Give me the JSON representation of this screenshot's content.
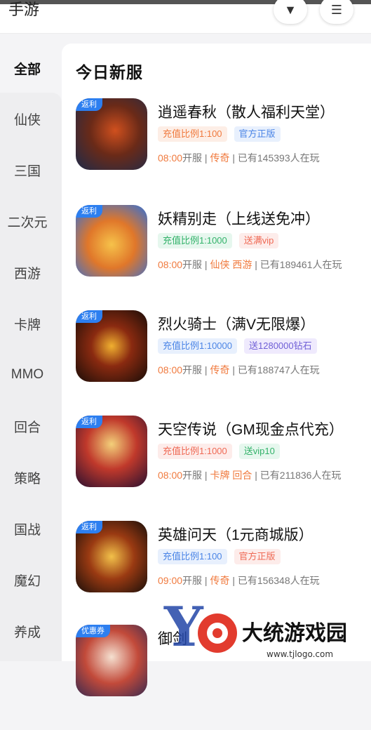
{
  "header": {
    "title": "手游"
  },
  "sidebar": {
    "items": [
      "全部",
      "仙侠",
      "三国",
      "二次元",
      "西游",
      "卡牌",
      "MMO",
      "回合",
      "策略",
      "国战",
      "魔幻",
      "养成"
    ]
  },
  "main": {
    "section_title": "今日新服",
    "games": [
      {
        "tag": "返利",
        "name": "逍遥春秋（散人福利天堂）",
        "chips": [
          "充值比例1:100",
          "官方正版"
        ],
        "time": "08:00",
        "open": "开服",
        "genres": [
          "传奇"
        ],
        "players": "已有145393人在玩"
      },
      {
        "tag": "返利",
        "name": "妖精别走（上线送免冲）",
        "chips": [
          "充值比例1:1000",
          "送满vip"
        ],
        "time": "08:00",
        "open": "开服",
        "genres": [
          "仙侠",
          "西游"
        ],
        "players": "已有189461人在玩"
      },
      {
        "tag": "返利",
        "name": "烈火骑士（满V无限爆）",
        "chips": [
          "充值比例1:10000",
          "送1280000钻石"
        ],
        "time": "08:00",
        "open": "开服",
        "genres": [
          "传奇"
        ],
        "players": "已有188747人在玩"
      },
      {
        "tag": "返利",
        "name": "天空传说（GM现金点代充）",
        "chips": [
          "充值比例1:1000",
          "送vip10"
        ],
        "time": "08:00",
        "open": "开服",
        "genres": [
          "卡牌",
          "回合"
        ],
        "players": "已有211836人在玩"
      },
      {
        "tag": "返利",
        "name": "英雄问天（1元商城版）",
        "chips": [
          "充值比例1:100",
          "官方正版"
        ],
        "time": "09:00",
        "open": "开服",
        "genres": [
          "传奇"
        ],
        "players": "已有156348人在玩"
      },
      {
        "tag": "优惠券",
        "name": "御剑",
        "chips": [],
        "time": "",
        "open": "",
        "genres": [],
        "players": ""
      }
    ]
  },
  "watermark": {
    "brand": "大统游戏园",
    "url": "www.tjlogo.com"
  },
  "colors": {
    "accent_orange": "#f07a3e",
    "accent_blue": "#4b85e6",
    "tag_blue": "#2d7ff0"
  }
}
